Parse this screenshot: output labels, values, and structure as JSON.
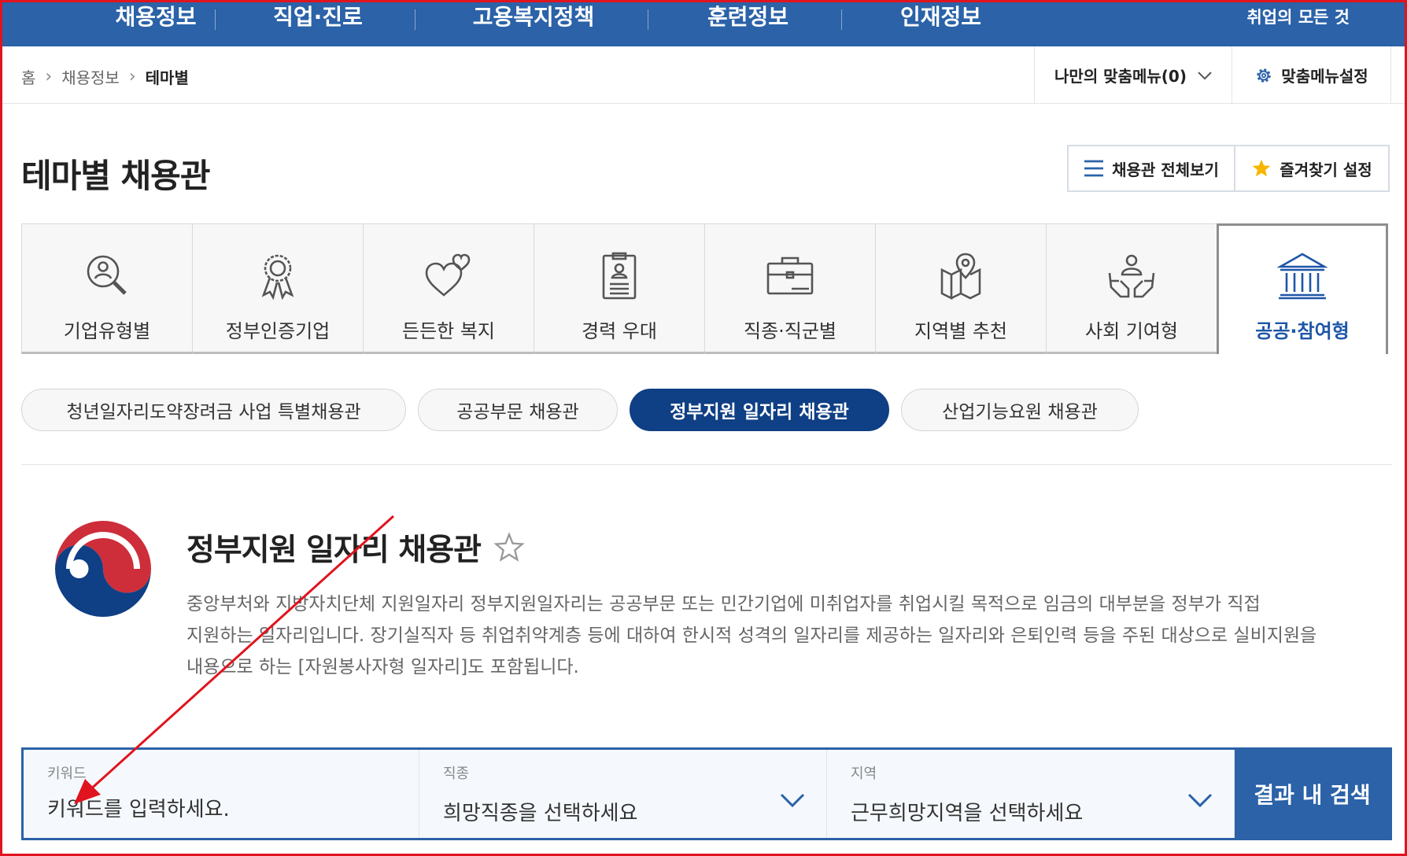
{
  "topnav": {
    "items": [
      "채용정보",
      "직업·진로",
      "고용복지정책",
      "훈련정보",
      "인재정보"
    ],
    "right": "취업의 모든 것"
  },
  "breadcrumb": {
    "home": "홈",
    "level1": "채용정보",
    "current": "테마별"
  },
  "mymenu": {
    "label": "나만의 맞춤메뉴(0)",
    "setting": "맞춤메뉴설정"
  },
  "page": {
    "title": "테마별 채용관",
    "view_all": "채용관 전체보기",
    "favorite": "즐겨찾기 설정"
  },
  "tabs": [
    {
      "label": "기업유형별",
      "icon": "search-person-icon"
    },
    {
      "label": "정부인증기업",
      "icon": "award-ribbon-icon"
    },
    {
      "label": "든든한 복지",
      "icon": "hearts-icon"
    },
    {
      "label": "경력 우대",
      "icon": "clipboard-profile-icon"
    },
    {
      "label": "직종·직군별",
      "icon": "briefcase-icon"
    },
    {
      "label": "지역별 추천",
      "icon": "map-pin-icon"
    },
    {
      "label": "사회 기여형",
      "icon": "hands-person-icon"
    },
    {
      "label": "공공·참여형",
      "icon": "government-building-icon"
    }
  ],
  "active_tab": "공공·참여형",
  "pills": [
    "청년일자리도약장려금 사업 특별채용관",
    "공공부문 채용관",
    "정부지원 일자리 채용관",
    "산업기능요원 채용관"
  ],
  "active_pill": "정부지원 일자리 채용관",
  "section": {
    "title": "정부지원 일자리 채용관",
    "desc": [
      "중앙부처와 지방자치단체 지원일자리 정부지원일자리는 공공부문 또는 민간기업에 미취업자를 취업시킬 목적으로 임금의 대부분을 정부가 직접",
      "지원하는 일자리입니다. 장기실직자 등 취업취약계층 등에 대하여 한시적 성격의 일자리를 제공하는 일자리와 은퇴인력 등을 주된 대상으로 실비지원을",
      "내용으로 하는 [자원봉사자형 일자리]도 포함됩니다."
    ]
  },
  "search": {
    "keyword_label": "키워드",
    "keyword_placeholder": "키워드를 입력하세요.",
    "job_label": "직종",
    "job_value": "희망직종을 선택하세요",
    "region_label": "지역",
    "region_value": "근무희망지역을 선택하세요",
    "button": "결과 내 검색"
  },
  "colors": {
    "primary": "#2b62a8",
    "active_pill": "#0f3f84",
    "active_tab_text": "#1e56a8",
    "annotation_arrow": "#e0141e",
    "star_yellow": "#f7b500"
  }
}
